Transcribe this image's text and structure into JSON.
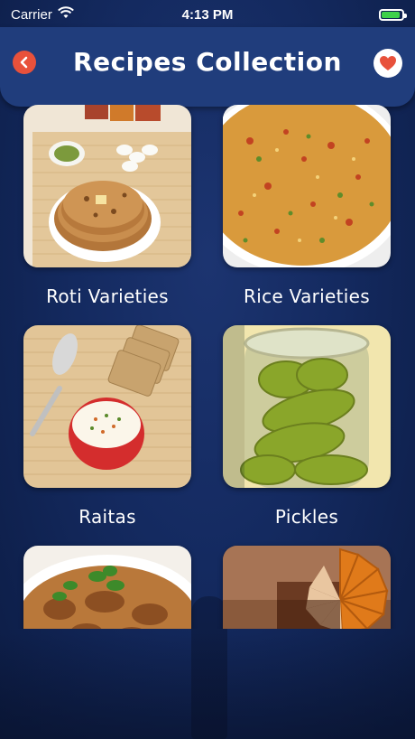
{
  "status": {
    "carrier": "Carrier",
    "time": "4:13 PM",
    "battery_level": 0.9
  },
  "header": {
    "title": "Recipes Collection",
    "back_icon": "chevron-left-icon",
    "favorite_icon": "heart-icon",
    "accent_color": "#e8513b"
  },
  "categories": [
    {
      "label": "Roti Varieties"
    },
    {
      "label": "Rice Varieties"
    },
    {
      "label": "Raitas"
    },
    {
      "label": "Pickles"
    },
    {
      "label": ""
    },
    {
      "label": ""
    }
  ]
}
